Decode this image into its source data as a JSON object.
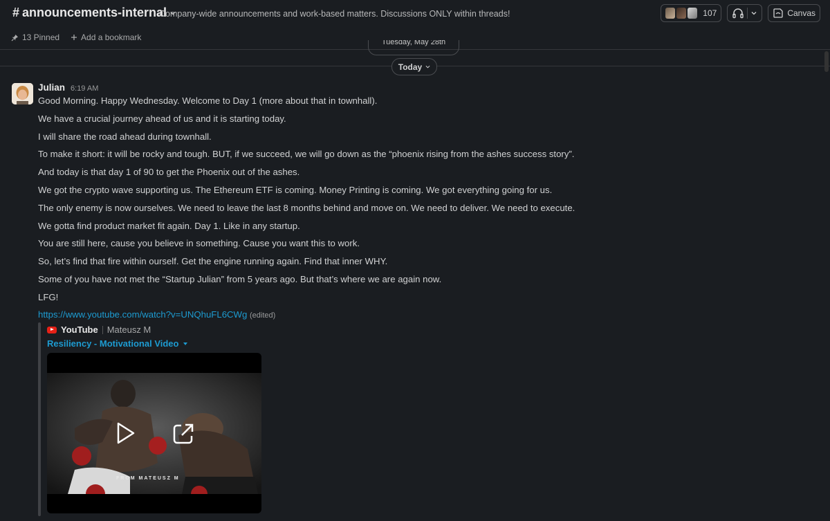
{
  "header": {
    "channel_hash": "#",
    "channel_name": "announcements-internal",
    "topic": "Company-wide announcements and work-based matters. Discussions ONLY within threads!",
    "member_count": "107",
    "canvas_label": "Canvas"
  },
  "bookmarks": {
    "pinned_label": "13 Pinned",
    "add_bookmark_label": "Add a bookmark"
  },
  "date_dividers": {
    "previous": "Tuesday, May 28th",
    "today": "Today"
  },
  "message": {
    "author": "Julian",
    "timestamp": "6:19 AM",
    "lines": [
      "Good Morning. Happy Wednesday. Welcome to Day 1 (more about that in townhall).",
      "We have a crucial journey ahead of us and it is starting today.",
      "I will share the road ahead during townhall.",
      "To make it short: it will be rocky and tough. BUT, if we succeed, we will go down as the “phoenix rising from the ashes success story”.",
      "And today is that day 1 of 90 to get the Phoenix out of the ashes.",
      "We got the crypto wave supporting us. The Ethereum ETF is coming. Money Printing is coming. We got everything going for us.",
      "The only enemy is now ourselves. We need to leave the last 8 months behind and move on. We need to deliver. We need to execute.",
      "We gotta find product market fit again. Day 1. Like in any startup.",
      "You are still here, cause you believe in something. Cause you want this to work.",
      "So, let’s find that fire within ourself. Get the engine running again. Find that inner WHY.",
      "Some of you have not met the “Startup Julian” from 5 years ago. But that’s where we are again now.",
      "LFG!"
    ],
    "link": "https://www.youtube.com/watch?v=UNQhuFL6CWg",
    "edited_label": "(edited)"
  },
  "unfurl": {
    "source": "YouTube",
    "author": "Mateusz M",
    "title": "Resiliency - Motivational Video",
    "watermark": "FROM MATEUSZ M",
    "brand_color": "#e62117",
    "link_color": "#1d9bd1"
  }
}
